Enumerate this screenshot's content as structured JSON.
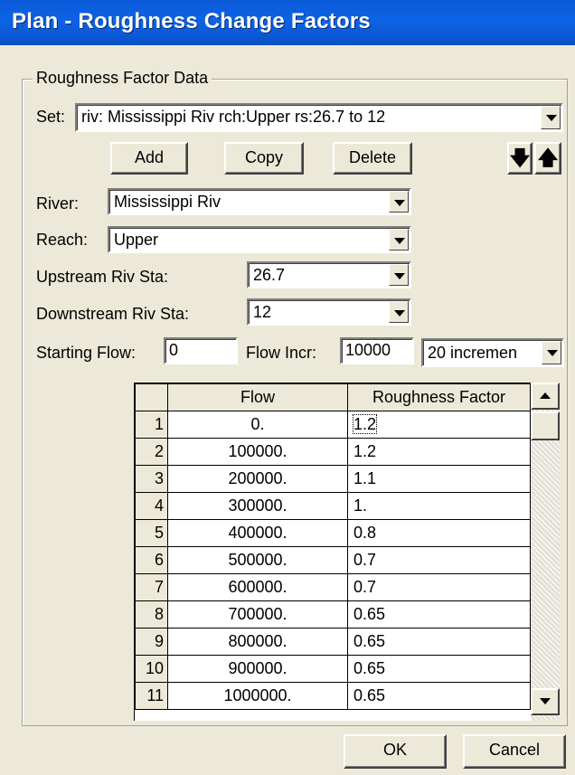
{
  "window": {
    "title": "Plan - Roughness Change Factors"
  },
  "group": {
    "label": "Roughness Factor Data"
  },
  "set": {
    "label": "Set:",
    "value": "riv: Mississippi Riv rch:Upper rs:26.7  to 12"
  },
  "buttons": {
    "add": "Add",
    "copy": "Copy",
    "delete": "Delete",
    "ok": "OK",
    "cancel": "Cancel"
  },
  "icons": {
    "move_down": "arrow-down-icon",
    "move_up": "arrow-up-icon"
  },
  "river": {
    "label": "River:",
    "value": "Mississippi Riv"
  },
  "reach": {
    "label": "Reach:",
    "value": "Upper"
  },
  "upstream": {
    "label": "Upstream Riv Sta:",
    "value": "26.7"
  },
  "downstream": {
    "label": "Downstream Riv Sta:",
    "value": "12"
  },
  "flow": {
    "starting_label": "Starting Flow:",
    "starting_value": "0",
    "incr_label": "Flow Incr:",
    "incr_value": "10000",
    "increments_value": "20 incremen"
  },
  "table": {
    "headers": [
      "",
      "Flow",
      "Roughness Factor"
    ],
    "rows": [
      [
        "1",
        "0.",
        "1.2"
      ],
      [
        "2",
        "100000.",
        "1.2"
      ],
      [
        "3",
        "200000.",
        "1.1"
      ],
      [
        "4",
        "300000.",
        "1."
      ],
      [
        "5",
        "400000.",
        "0.8"
      ],
      [
        "6",
        "500000.",
        "0.7"
      ],
      [
        "7",
        "600000.",
        "0.7"
      ],
      [
        "8",
        "700000.",
        "0.65"
      ],
      [
        "9",
        "800000.",
        "0.65"
      ],
      [
        "10",
        "900000.",
        "0.65"
      ],
      [
        "11",
        "1000000.",
        "0.65"
      ]
    ]
  }
}
